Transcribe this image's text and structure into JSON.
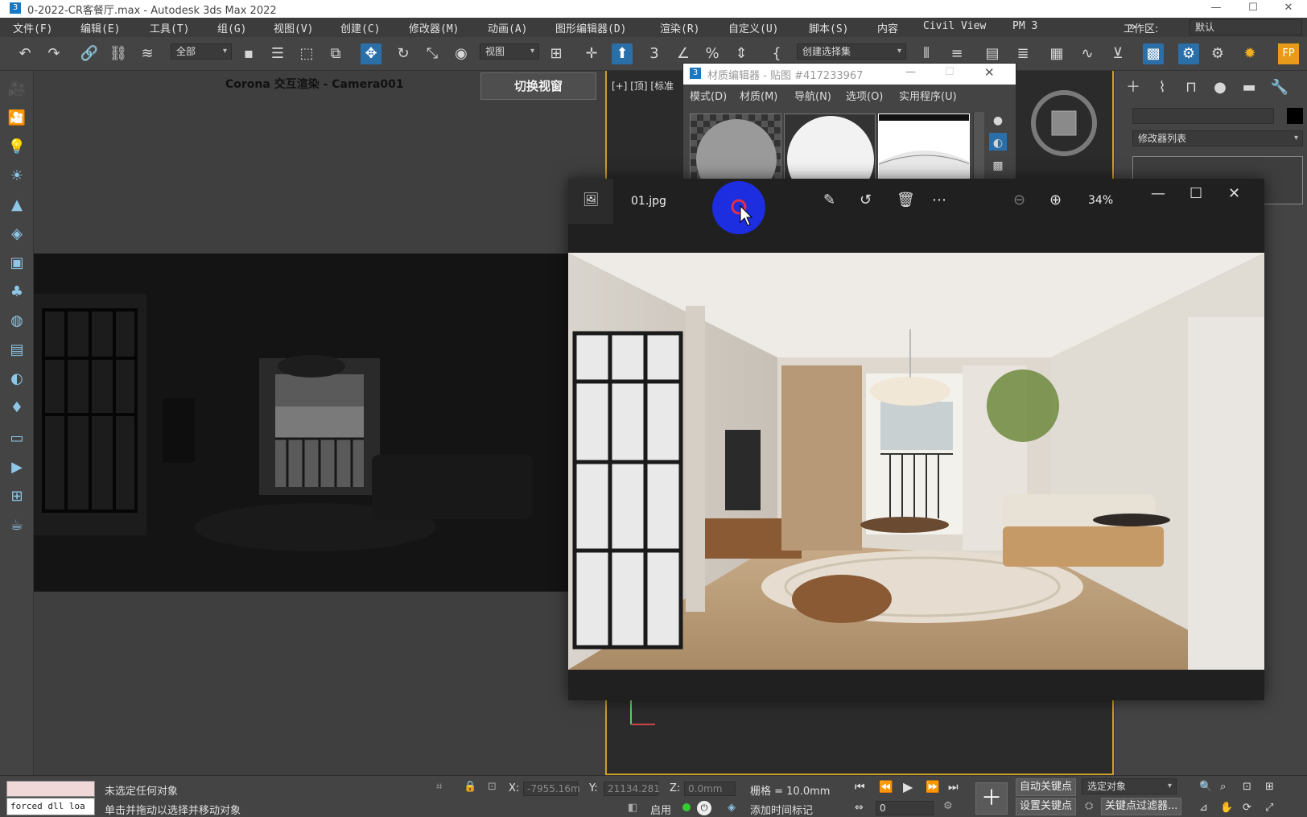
{
  "titlebar": {
    "app_icon": "3",
    "title": "0-2022-CR客餐厅.max - Autodesk 3ds Max 2022",
    "minimize": "—",
    "maximize": "☐",
    "close": "✕"
  },
  "menu": {
    "items": [
      "文件(F)",
      "编辑(E)",
      "工具(T)",
      "组(G)",
      "视图(V)",
      "创建(C)",
      "修改器(M)",
      "动画(A)",
      "图形编辑器(D)",
      "渲染(R)",
      "自定义(U)",
      "脚本(S)",
      "内容",
      "Civil View",
      "PM 3"
    ],
    "overflow": "»",
    "workspace_label": "工作区:",
    "workspace_value": "默认"
  },
  "toolbar": {
    "selection_filter": "全部",
    "ref_coord": "视图",
    "named_selection": "创建选择集"
  },
  "viewport": {
    "title": "Corona 交互渲染 - Camera001",
    "switch_button": "切换视窗",
    "right_label": "[+] [顶] [标准"
  },
  "material_editor": {
    "title": "材质编辑器 - 贴图 #417233967",
    "menu": [
      "模式(D)",
      "材质(M)",
      "导航(N)",
      "选项(O)",
      "实用程序(U)"
    ]
  },
  "command_panel": {
    "modifier_list": "修改器列表"
  },
  "photo_viewer": {
    "filename": "01.jpg",
    "zoom": "34%",
    "icons": [
      "image-icon",
      "edit-image-icon",
      "rotate-icon",
      "delete-icon",
      "more-icon",
      "zoom-out-icon",
      "zoom-in-icon"
    ]
  },
  "status": {
    "maxscript": "forced dll loa",
    "selection_info": "未选定任何对象",
    "prompt": "单击并拖动以选择并移动对象",
    "x_label": "X:",
    "x_value": "-7955.16m",
    "y_label": "Y:",
    "y_value": "21134.281",
    "z_label": "Z:",
    "z_value": "0.0mm",
    "grid": "栅格 = 10.0mm",
    "enable_label": "启用",
    "add_time_tag": "添加时间标记",
    "auto_key": "自动关键点",
    "selected_object": "选定对象",
    "set_key": "设置关键点",
    "key_filters": "关键点过滤器...",
    "frame": "0"
  },
  "colors": {
    "accent_blue": "#2b6fa8",
    "viewport_border": "#c8a02a",
    "cursor_circle": "#1d2de0"
  }
}
